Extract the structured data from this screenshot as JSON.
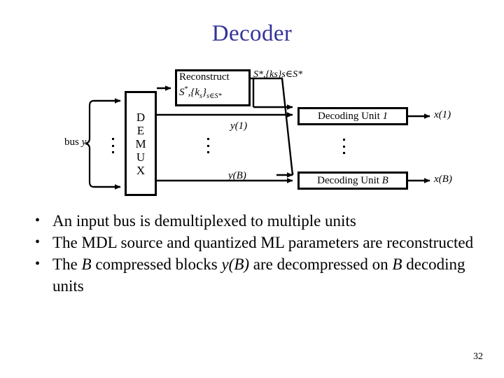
{
  "slide": {
    "title": "Decoder",
    "title_color": "#333399",
    "page_number": "32"
  },
  "diagram": {
    "bus_label_text": "bus",
    "bus_label_var": "y",
    "demux": {
      "name": "DEMUX",
      "letters": [
        "D",
        "E",
        "M",
        "U",
        "X"
      ]
    },
    "reconstruct_box": {
      "line1": "Reconstruct",
      "line2_base": "S",
      "line2_star": "*",
      "line2_comma": ",{",
      "line2_k": "k",
      "line2_k_sub": "s",
      "line2_close": "}",
      "line2_tail_sub": "s",
      "line2_in": "∈",
      "line2_tail": "S*",
      "full_text": "Reconstruct S*,{ks}s∈S*"
    },
    "reconstruct_output_label": "S*,{ks}s∈S*",
    "signals": {
      "y1": "y(1)",
      "yB": "y(B)",
      "x1": "x(1)",
      "xB": "x(B)"
    },
    "decoding_units": [
      {
        "label_text": "Decoding Unit",
        "label_index": "1",
        "output": "x(1)"
      },
      {
        "label_text": "Decoding Unit",
        "label_index": "B",
        "output": "x(B)"
      }
    ],
    "ellipsis": "⋮"
  },
  "bullets": [
    {
      "id": "bullet-demultiplex",
      "parts": [
        {
          "text": "An input bus is demultiplexed to multiple units",
          "italic": false
        }
      ]
    },
    {
      "id": "bullet-reconstruct",
      "parts": [
        {
          "text": "The MDL source and quantized ML parameters are reconstructed",
          "italic": false
        }
      ]
    },
    {
      "id": "bullet-blocks",
      "parts": [
        {
          "text": "The ",
          "italic": false
        },
        {
          "text": "B",
          "italic": true
        },
        {
          "text": " compressed blocks ",
          "italic": false
        },
        {
          "text": "y(B)",
          "italic": true
        },
        {
          "text": " are decompressed on ",
          "italic": false
        },
        {
          "text": "B",
          "italic": true
        },
        {
          "text": " decoding units",
          "italic": false
        }
      ]
    }
  ]
}
